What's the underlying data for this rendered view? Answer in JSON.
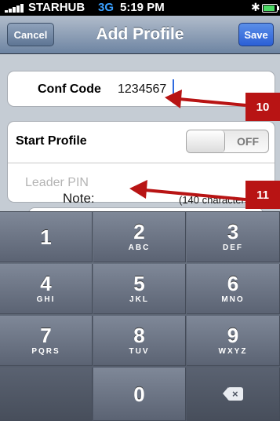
{
  "status_bar": {
    "carrier": "STARHUB",
    "network": "3G",
    "time": "5:19 PM",
    "bluetooth_icon": "bluetooth-icon",
    "battery_icon": "battery-icon"
  },
  "navbar": {
    "title": "Add Profile",
    "cancel_label": "Cancel",
    "save_label": "Save"
  },
  "form": {
    "conf_code_label": "Conf Code",
    "conf_code_value": "1234567",
    "start_profile_label": "Start Profile",
    "toggle_state": "OFF",
    "leader_pin_placeholder": "Leader PIN",
    "note_label": "Note:",
    "note_count": "(140 characters)"
  },
  "annotations": {
    "callout_a": "10",
    "callout_b": "11",
    "color": "#b81414"
  },
  "keyboard": {
    "keys": [
      {
        "digit": "1",
        "letters": ""
      },
      {
        "digit": "2",
        "letters": "ABC"
      },
      {
        "digit": "3",
        "letters": "DEF"
      },
      {
        "digit": "4",
        "letters": "GHI"
      },
      {
        "digit": "5",
        "letters": "JKL"
      },
      {
        "digit": "6",
        "letters": "MNO"
      },
      {
        "digit": "7",
        "letters": "PQRS"
      },
      {
        "digit": "8",
        "letters": "TUV"
      },
      {
        "digit": "9",
        "letters": "WXYZ"
      },
      {
        "digit": "0",
        "letters": ""
      }
    ],
    "delete_icon": "delete-backspace-icon"
  }
}
